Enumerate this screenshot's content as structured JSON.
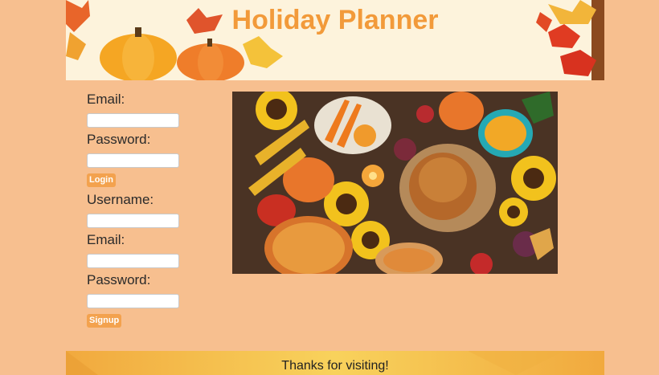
{
  "banner": {
    "title": "Holiday Planner"
  },
  "login": {
    "email_label": "Email:",
    "password_label": "Password:",
    "button_label": "Login"
  },
  "signup": {
    "username_label": "Username:",
    "email_label": "Email:",
    "password_label": "Password:",
    "button_label": "Signup"
  },
  "footer": {
    "text": "Thanks for visiting!"
  },
  "colors": {
    "page_bg": "#f7bf8f",
    "title": "#f29a3a",
    "button": "#f3a24e"
  }
}
